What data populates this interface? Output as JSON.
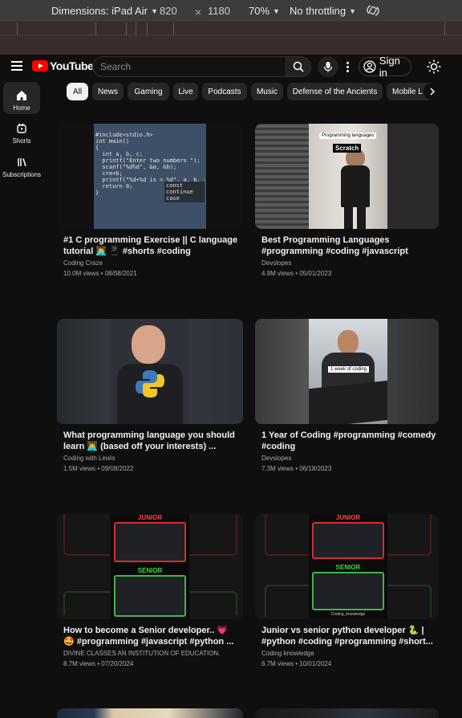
{
  "devtools": {
    "dimensions_label": "Dimensions: iPad Air",
    "width": "820",
    "height": "1180",
    "zoom": "70%",
    "throttling": "No throttling"
  },
  "header": {
    "logo_text": "YouTube",
    "search_placeholder": "Search",
    "signin_label": "Sign in"
  },
  "sidebar": {
    "items": [
      {
        "label": "Home",
        "icon": "home-icon"
      },
      {
        "label": "Shorts",
        "icon": "shorts-icon"
      },
      {
        "label": "Subscriptions",
        "icon": "subscriptions-icon"
      }
    ]
  },
  "chips": [
    "All",
    "News",
    "Gaming",
    "Live",
    "Podcasts",
    "Music",
    "Defense of the Ancients",
    "Mobile L"
  ],
  "videos": [
    {
      "title": "#1 C programming Exercise || C language tutorial 👨‍💻 📱 #shorts #coding",
      "channel": "Coding Craze",
      "meta": "10.0M views • 08/08/2021"
    },
    {
      "title": "Best Programming Languages #programming #coding #javascript",
      "channel": "Devslopes",
      "meta": "4.9M views • 05/01/2023"
    },
    {
      "title": "What programming language you should learn 👨‍💻 (based off your interests) ...",
      "channel": "Coding with Lewis",
      "meta": "1.5M views • 09/08/2022"
    },
    {
      "title": "1 Year of Coding #programming #comedy #coding",
      "channel": "Devslopes",
      "meta": "7.3M views • 06/18/2023"
    },
    {
      "title": "How to become a Senior developer.. 💗 🤩 #programming #javascript #python ...",
      "channel": "DIVINE CLASSES AN INSTITUTION OF EDUCATION.",
      "meta": "8.7M views • 07/20/2024"
    },
    {
      "title": "Junior vs senior python developer 🐍 | #python #coding #programming #short...",
      "channel": "Coding knowledge",
      "meta": "6.7M views • 10/01/2024"
    }
  ],
  "thumb_text": {
    "v1_code": "#include<stdio.h>\nint main()\n{\n  int a, b, c;\n  printf(\"Enter two numbers \");\n  scanf(\"%d%d\", &a, &b);\n  c=a+b;\n  printf(\"%d+%d is = %d\", a, b, c);\n  return 0;\n}",
    "v1_suggest": [
      "const",
      "continue",
      "case"
    ],
    "v2_label1": "Programming languages",
    "v2_label2": "Scratch",
    "v4_label": "1 week of coding",
    "v5_junior": "JUNIOR",
    "v5_senior": "SENIOR",
    "v6_junior": "JUNIOR",
    "v6_senior": "SENIOR",
    "v6_caption": "Coding_knowledge"
  }
}
